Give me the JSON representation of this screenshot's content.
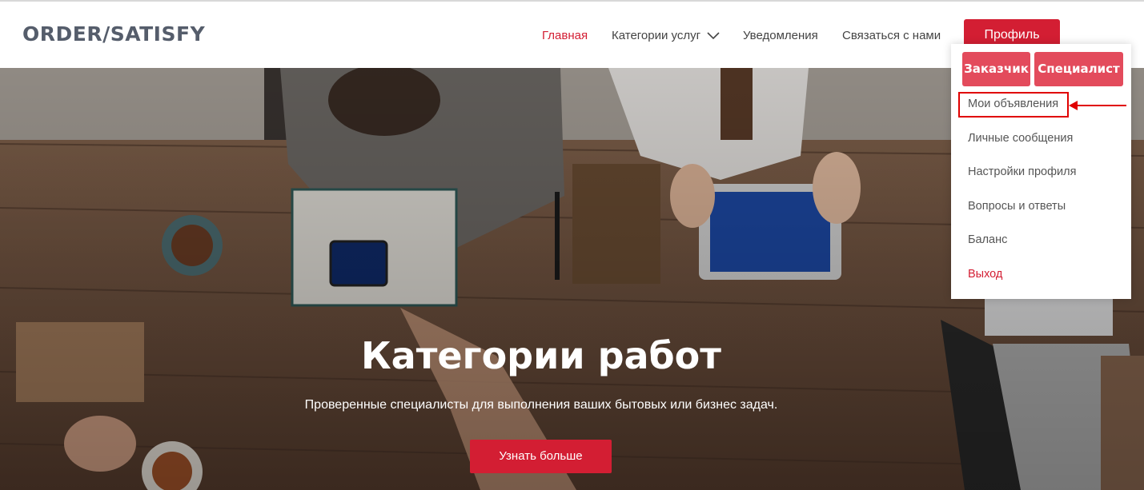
{
  "header": {
    "logo": "ORDER/SATISFY",
    "nav": [
      {
        "label": "Главная"
      },
      {
        "label": "Категории услуг"
      },
      {
        "label": "Уведомления"
      },
      {
        "label": "Связаться с нами"
      }
    ],
    "profile_label": "Профиль"
  },
  "dropdown": {
    "customer_label": "Заказчик",
    "specialist_label": "Специалист",
    "items": [
      {
        "label": "Мои объявления"
      },
      {
        "label": "Личные сообщения"
      },
      {
        "label": "Настройки профиля"
      },
      {
        "label": "Вопросы и ответы"
      },
      {
        "label": "Баланс"
      },
      {
        "label": "Выход"
      }
    ]
  },
  "hero": {
    "title": "Категории работ",
    "subtitle": "Проверенные специалисты для выполнения ваших бытовых или бизнес задач.",
    "button_label": "Узнать больше"
  },
  "colors": {
    "accent": "#d31e33",
    "dropdown_button": "#e34b5c",
    "annotation": "#e00000"
  },
  "icons": {
    "nav_dropdown": "chevron-down-icon",
    "annotation": "arrow-left-icon"
  }
}
